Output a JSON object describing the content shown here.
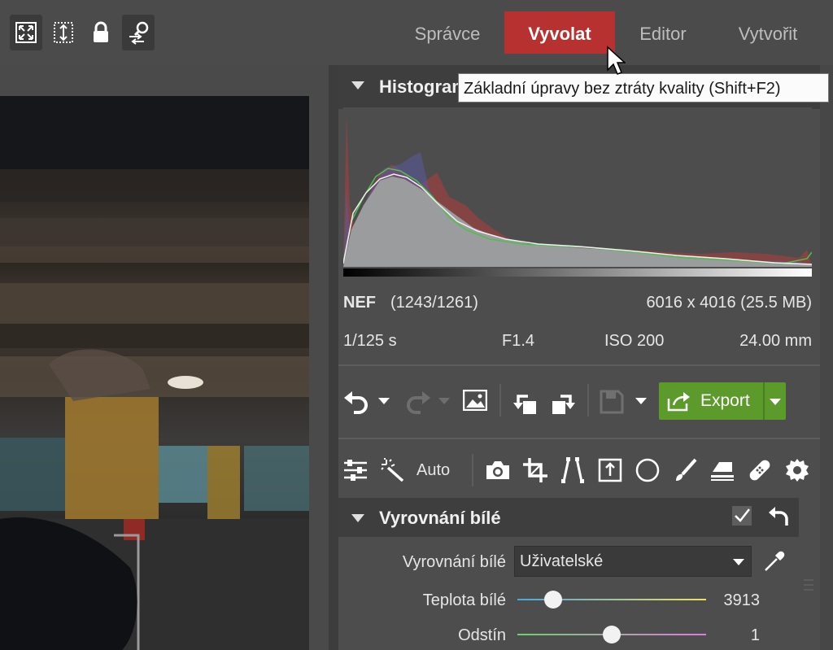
{
  "tabs": [
    {
      "label": "Správce"
    },
    {
      "label": "Vyvolat"
    },
    {
      "label": "Editor"
    },
    {
      "label": "Vytvořit"
    }
  ],
  "tooltip": "Základní úpravy bez ztráty kvality (Shift+F2)",
  "histogram": {
    "title": "Histogram"
  },
  "file_info": {
    "format": "NEF",
    "index": "(1243/1261)",
    "dimensions": "6016 x 4016 (25.5 MB)",
    "shutter": "1/125 s",
    "aperture": "F1.4",
    "iso": "ISO 200",
    "focal": "24.00 mm"
  },
  "toolbar": {
    "export_label": "Export",
    "auto_label": "Auto"
  },
  "white_balance": {
    "title": "Vyrovnání bílé",
    "mode_label": "Vyrovnání bílé",
    "mode_value": "Uživatelské",
    "temp_label": "Teplota bílé",
    "temp_value": "3913",
    "temp_fraction": 0.19,
    "tint_label": "Odstín",
    "tint_value": "1",
    "tint_fraction": 0.5
  },
  "colors": {
    "active_tab": "#b73131",
    "export": "#5c9a2b"
  }
}
